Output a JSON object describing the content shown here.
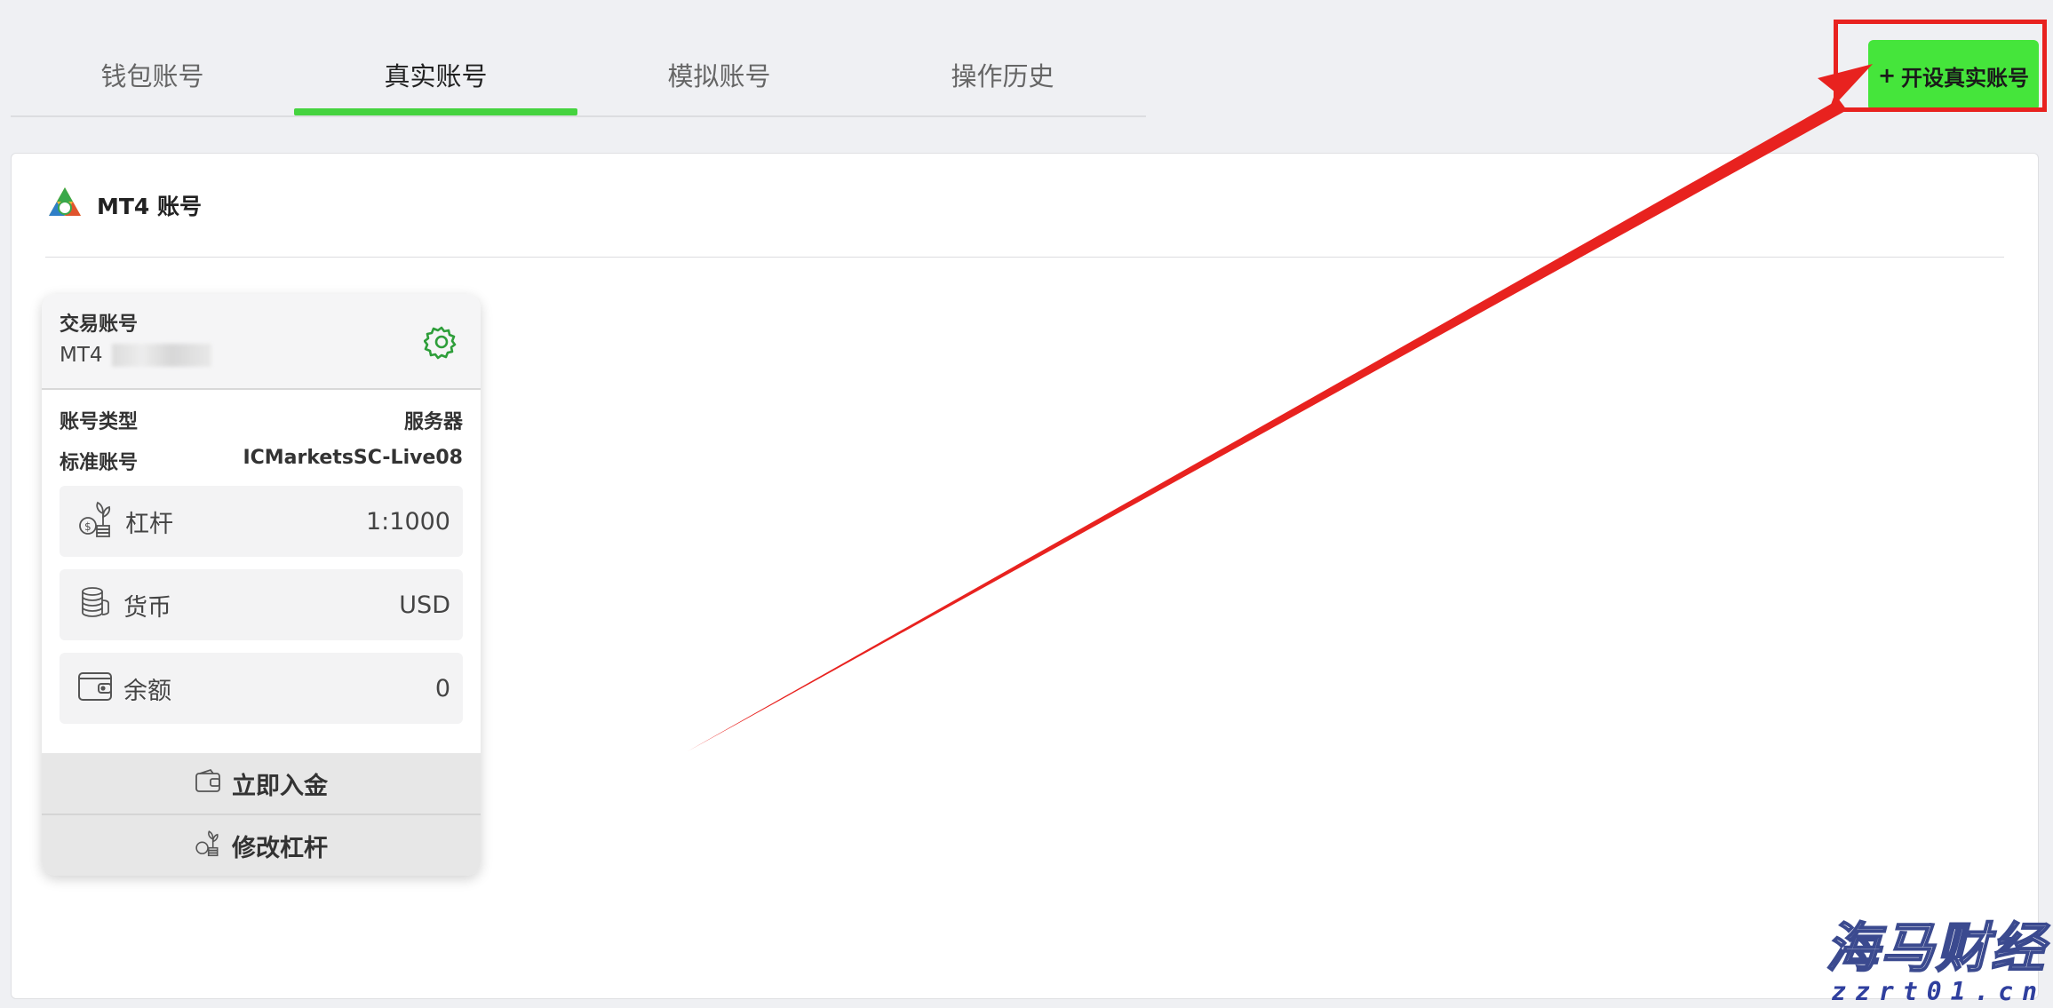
{
  "tabs": [
    {
      "label": "钱包账号",
      "active": false
    },
    {
      "label": "真实账号",
      "active": true
    },
    {
      "label": "模拟账号",
      "active": false
    },
    {
      "label": "操作历史",
      "active": false
    }
  ],
  "open_button": {
    "plus": "+",
    "label": "开设真实账号"
  },
  "panel": {
    "title": "MT4 账号"
  },
  "card": {
    "trade_account_label": "交易账号",
    "account_prefix": "MT4",
    "account_type_label": "账号类型",
    "account_type_value": "标准账号",
    "server_label": "服务器",
    "server_value": "ICMarketsSC-Live08",
    "leverage": {
      "label": "杠杆",
      "value": "1:1000"
    },
    "currency": {
      "label": "货币",
      "value": "USD"
    },
    "balance": {
      "label": "余额",
      "value": "0"
    },
    "deposit_label": "立即入金",
    "modify_leverage_label": "修改杠杆"
  },
  "watermark": {
    "main": "海马财经",
    "sub": "zzrt01.cn"
  },
  "colors": {
    "accent": "#45e53b",
    "tab_underline": "#45d33f",
    "annotation": "#e8221f",
    "gear": "#2e9e3a"
  }
}
